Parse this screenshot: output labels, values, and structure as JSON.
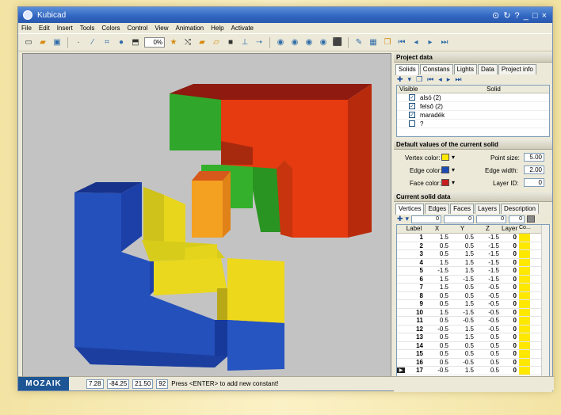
{
  "window": {
    "title": "Kubicad",
    "controls": "⊙ ↻ ? _ □ ×"
  },
  "menu": [
    "File",
    "Edit",
    "Insert",
    "Tools",
    "Colors",
    "Control",
    "View",
    "Animation",
    "Help",
    "Activate"
  ],
  "toolbar": {
    "zoom": "0%"
  },
  "panel": {
    "project_header": "Project data",
    "tabs": [
      "Solids",
      "Constans",
      "Lights",
      "Data",
      "Project info"
    ],
    "solids_columns": [
      "Visible",
      "Solid"
    ],
    "solids": [
      {
        "checked": "✓",
        "name": "alsó (2)"
      },
      {
        "checked": "✓",
        "name": "felső (2)"
      },
      {
        "checked": "✓",
        "name": "maradék"
      },
      {
        "checked": "",
        "name": "?"
      }
    ],
    "defaults_header": "Default values of the current solid",
    "defaults": {
      "vertex_label": "Vertex color:",
      "edge_label": "Edge color:",
      "face_label": "Face color:",
      "point_size_label": "Point size:",
      "point_size": "5.00",
      "edge_width_label": "Edge width:",
      "edge_width": "2.00",
      "layer_label": "Layer ID:",
      "layer": "0",
      "vertex_color": "#ffe800",
      "edge_color": "#1e4bb3",
      "face_color": "#c41e1e"
    },
    "current_header": "Current solid data",
    "current_tabs": [
      "Vertices",
      "Edges",
      "Faces",
      "Layers",
      "Description"
    ],
    "filter_values": [
      "0",
      "0",
      "0",
      "0"
    ],
    "vertex_columns": [
      "Label",
      "X",
      "Y",
      "Z",
      "Layer",
      "Co..."
    ],
    "vertices": [
      [
        "1",
        "1.5",
        "0.5",
        "-1.5",
        "0"
      ],
      [
        "2",
        "0.5",
        "0.5",
        "-1.5",
        "0"
      ],
      [
        "3",
        "0.5",
        "1.5",
        "-1.5",
        "0"
      ],
      [
        "4",
        "1.5",
        "1.5",
        "-1.5",
        "0"
      ],
      [
        "5",
        "-1.5",
        "1.5",
        "-1.5",
        "0"
      ],
      [
        "6",
        "1.5",
        "-1.5",
        "-1.5",
        "0"
      ],
      [
        "7",
        "1.5",
        "0.5",
        "-0.5",
        "0"
      ],
      [
        "8",
        "0.5",
        "0.5",
        "-0.5",
        "0"
      ],
      [
        "9",
        "0.5",
        "1.5",
        "-0.5",
        "0"
      ],
      [
        "10",
        "1.5",
        "-1.5",
        "-0.5",
        "0"
      ],
      [
        "11",
        "0.5",
        "-0.5",
        "-0.5",
        "0"
      ],
      [
        "12",
        "-0.5",
        "1.5",
        "-0.5",
        "0"
      ],
      [
        "13",
        "0.5",
        "1.5",
        "0.5",
        "0"
      ],
      [
        "14",
        "0.5",
        "0.5",
        "0.5",
        "0"
      ],
      [
        "15",
        "0.5",
        "0.5",
        "0.5",
        "0"
      ],
      [
        "16",
        "0.5",
        "-0.5",
        "0.5",
        "0"
      ],
      [
        "17",
        "-0.5",
        "1.5",
        "0.5",
        "0"
      ]
    ]
  },
  "status": {
    "brand": "MOZAIK",
    "v1": "7.28",
    "v2": "-84.25",
    "v3": "21.50",
    "v4": "92",
    "message": "Press <ENTER> to add new constant!"
  },
  "colors": {
    "blue": "#1e4bb3",
    "yellow": "#e8d21a",
    "red": "#e63a10",
    "green": "#2fa824",
    "orange": "#f0a020"
  }
}
